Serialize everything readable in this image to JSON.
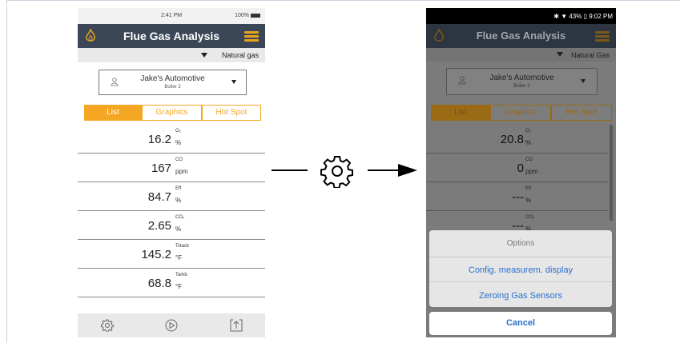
{
  "left_phone": {
    "status_time": "2:41 PM",
    "status_battery": "100%",
    "title": "Flue Gas Analysis",
    "fuel": "Natural gas",
    "customer": {
      "name": "Jake's Automotive",
      "sub": "Boiler 2"
    },
    "tabs": [
      "List",
      "Graphics",
      "Hot Spot"
    ],
    "active_tab": "List",
    "rows": [
      {
        "value": "16.2",
        "param": "O₂",
        "unit": "%"
      },
      {
        "value": "167",
        "param": "CO",
        "unit": "ppm"
      },
      {
        "value": "84.7",
        "param": "Eff",
        "unit": "%"
      },
      {
        "value": "2.65",
        "param": "CO₂",
        "unit": "%"
      },
      {
        "value": "145.2",
        "param": "Tstack",
        "unit": "°F"
      },
      {
        "value": "68.8",
        "param": "Tamb",
        "unit": "°F"
      }
    ],
    "bottom_icons": [
      "gear-icon",
      "play-icon",
      "export-icon"
    ]
  },
  "right_phone": {
    "status": "✱ ▼ 43% ▯ 9:02 PM",
    "title": "Flue Gas Analysis",
    "fuel": "Natural Gas",
    "customer": {
      "name": "Jake's Automotive",
      "sub": "Boiler 2"
    },
    "tabs": [
      "List",
      "Graphics",
      "Hot Spot"
    ],
    "active_tab": "List",
    "rows": [
      {
        "value": "20.8",
        "param": "O₂",
        "unit": "%"
      },
      {
        "value": "0",
        "param": "CO",
        "unit": "ppm"
      },
      {
        "value": "---",
        "param": "Eff",
        "unit": "%"
      },
      {
        "value": "---",
        "param": "CO₂",
        "unit": "%"
      }
    ],
    "options": {
      "title": "Options",
      "items": [
        "Config. measurem. display",
        "Zeroing Gas Sensors"
      ],
      "cancel": "Cancel"
    }
  },
  "colors": {
    "accent": "#f5a623",
    "header": "#3b4756",
    "link": "#2a6fcc"
  }
}
